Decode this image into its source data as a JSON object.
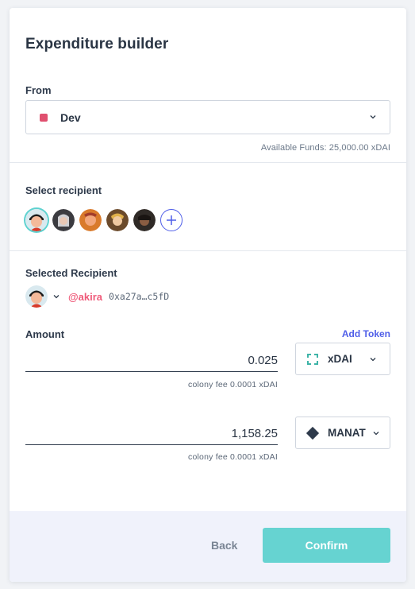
{
  "dialog": {
    "title": "Expenditure builder"
  },
  "from": {
    "label": "From",
    "selected": "Dev",
    "swatch_color": "#e0506f",
    "available_funds": "Available Funds: 25,000.00 xDAI"
  },
  "recipients": {
    "label": "Select recipient",
    "avatars": [
      "akira",
      "user-2",
      "user-3",
      "user-4",
      "user-5"
    ]
  },
  "selected_recipient": {
    "label": "Selected Recipient",
    "handle": "@akira",
    "address": "0xa27a…c5fD"
  },
  "amount": {
    "label": "Amount",
    "add_token": "Add Token",
    "rows": [
      {
        "value": "0.025",
        "fee": "colony fee 0.0001 xDAI",
        "token": "xDAI",
        "token_icon": "xdai-icon"
      },
      {
        "value": "1,158.25",
        "fee": "colony fee 0.0001 xDAI",
        "token": "MANAT",
        "token_icon": "manat-diamond-icon"
      }
    ]
  },
  "footer": {
    "back_label": "Back",
    "confirm_label": "Confirm"
  },
  "colors": {
    "accent": "#66d3d1",
    "link": "#4f5ee8",
    "handle": "#ef5b7a"
  }
}
